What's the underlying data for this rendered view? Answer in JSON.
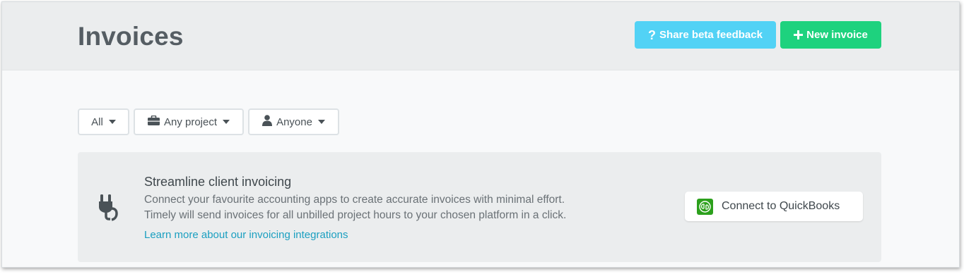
{
  "header": {
    "title": "Invoices",
    "feedback_label": "Share beta feedback",
    "new_invoice_label": "New invoice",
    "colors": {
      "feedback": "#52d2f5",
      "new_invoice": "#1ed27e"
    }
  },
  "filters": {
    "status": "All",
    "project": "Any project",
    "person": "Anyone"
  },
  "banner": {
    "title": "Streamline client invoicing",
    "line1": "Connect your favourite accounting apps to create accurate invoices with minimal effort.",
    "line2": "Timely will send invoices for all unbilled project hours to your chosen platform in a click.",
    "link": "Learn more about our invoicing integrations",
    "icon": "plug-icon",
    "connect_label": "Connect to QuickBooks",
    "link_color": "#1a9fc0"
  }
}
